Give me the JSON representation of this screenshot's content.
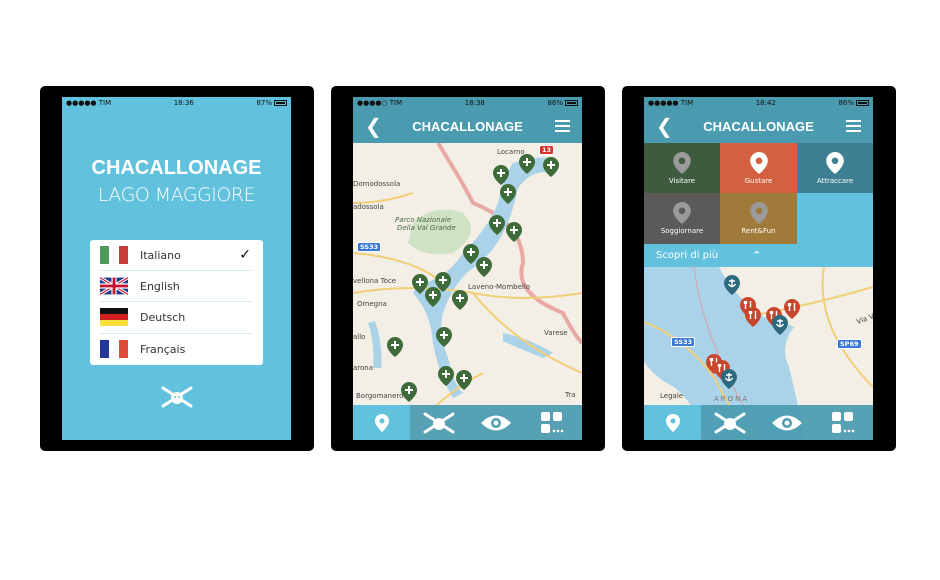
{
  "phones": [
    {
      "status": {
        "carrier": "●●●●● TIM",
        "time": "18:36",
        "battery": "87%",
        "battery_level": 87
      },
      "title": "CHACALLONAGE",
      "subtitle": "LAGO MAGGIORE",
      "languages": [
        {
          "label": "Italiano",
          "flag": "it",
          "selected": true
        },
        {
          "label": "English",
          "flag": "gb",
          "selected": false
        },
        {
          "label": "Deutsch",
          "flag": "de",
          "selected": false
        },
        {
          "label": "Français",
          "flag": "fr",
          "selected": false
        }
      ],
      "check": "✓"
    },
    {
      "status": {
        "carrier": "●●●●○ TIM",
        "time": "18:38",
        "battery": "86%",
        "battery_level": 86
      },
      "nav_title": "CHACALLONAGE",
      "map": {
        "labels": [
          "Locarno",
          "Domodossola",
          "adossola",
          "Parco Nazionale",
          "Della Val Grande",
          "vellona Toce",
          "Laveno-Mombello",
          "Omegna",
          "allo",
          "Varese",
          "arona",
          "Borgomanero",
          "Tra"
        ],
        "shields": [
          "SS33",
          "13"
        ],
        "pin_color": "#3f6b3a"
      }
    },
    {
      "status": {
        "carrier": "●●●●● TIM",
        "time": "18:42",
        "battery": "86%",
        "battery_level": 86
      },
      "nav_title": "CHACALLONAGE",
      "categories": [
        {
          "label": "Visitare",
          "icon": "eye",
          "color": "#3e5b3f"
        },
        {
          "label": "Gustare",
          "icon": "fork-knife",
          "color": "#d3603f"
        },
        {
          "label": "Attraccare",
          "icon": "anchor",
          "color": "#3f7f93"
        },
        {
          "label": "Soggiornare",
          "icon": "bed",
          "color": "#5b5a58"
        },
        {
          "label": "Rent&Fun",
          "icon": "sailboat",
          "color": "#a07a3a"
        }
      ],
      "scopri": "Scopri di più",
      "map": {
        "labels": [
          "Via Verdi",
          "Legale",
          "ARONA"
        ],
        "shields": [
          "SS33",
          "SP69"
        ],
        "restaurant_color": "#c8462e",
        "anchor_color": "#2e6a7e"
      }
    }
  ],
  "tabbar": [
    {
      "icon": "map-pin"
    },
    {
      "icon": "chacallonage-logo"
    },
    {
      "icon": "eye"
    },
    {
      "icon": "grid-more"
    }
  ]
}
